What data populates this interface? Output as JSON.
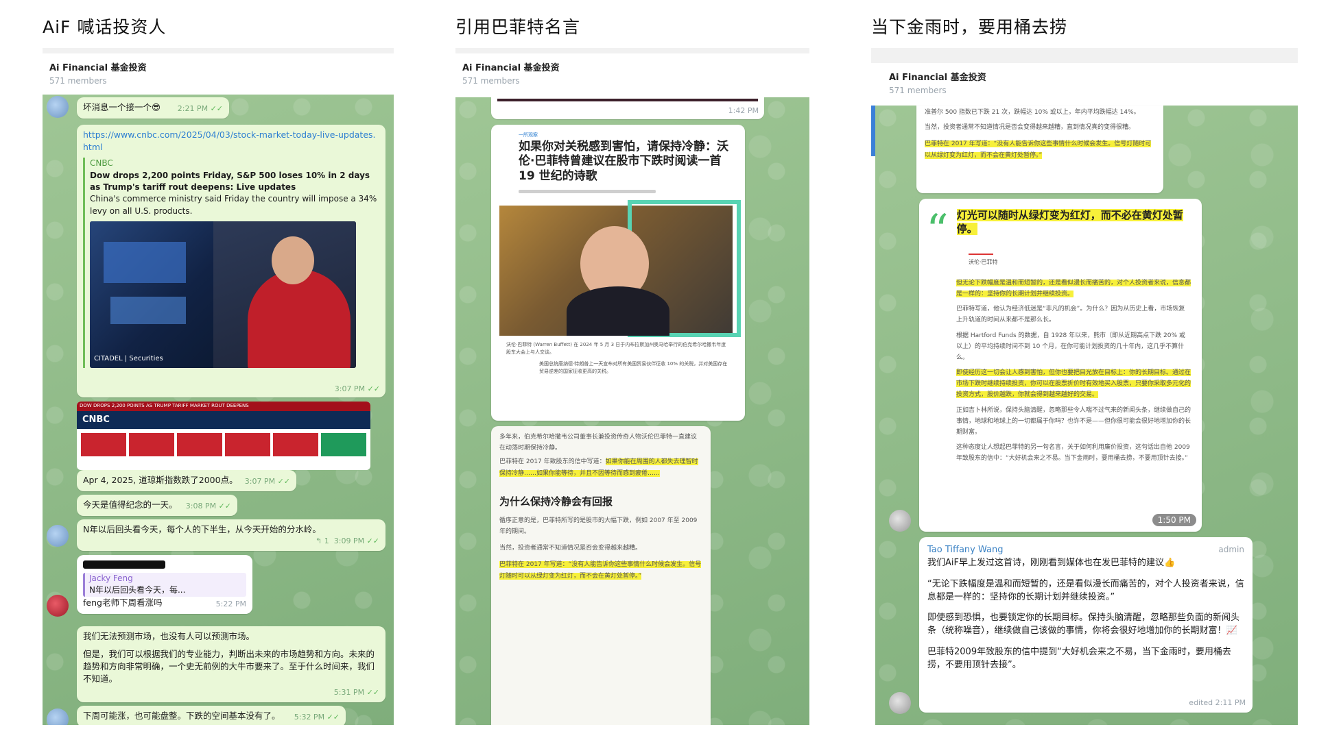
{
  "titles": [
    "AiF 喊话投资人",
    "引用巴菲特名言",
    "当下金雨时，要用桶去捞"
  ],
  "chat": {
    "name": "Ai Financial 基金投资",
    "members": "571 members"
  },
  "left": {
    "msg1": {
      "text": "坏消息一个接一个😎",
      "time": "2:21 PM"
    },
    "msg2": {
      "url": "https://www.cnbc.com/2025/04/03/stock-market-today-live-updates.html",
      "source": "CNBC",
      "headline": "Dow drops 2,200 points Friday, S&P 500 loses 10% in 2 days as Trump's tariff rout deepens: Live updates",
      "desc": "China's commerce ministry said Friday the country will impose a 34% levy on all U.S. products.",
      "img_caption": "CITADEL | Securities",
      "time": "3:07 PM"
    },
    "banner": {
      "brand": "CNBC",
      "ticker": "DOW DROPS 2,200 POINTS AS TRUMP TARIFF MARKET ROUT DEEPENS"
    },
    "msg3": {
      "text": "Apr 4, 2025, 道琼斯指数跌了2000点。",
      "time": "3:07 PM"
    },
    "msg4": {
      "text": "今天是值得纪念的一天。",
      "time": "3:08 PM"
    },
    "msg5": {
      "text": "N年以后回头看今天，每个人的下半生，从今天开始的分水岭。",
      "replies": "↰ 1",
      "time": "3:09 PM"
    },
    "msg6": {
      "reply_name": "Jacky Feng",
      "reply_text": "N年以后回头看今天，每...",
      "text": "feng老师下周看涨吗",
      "time": "5:22 PM"
    },
    "msg7": {
      "p1": "我们无法预测市场，也没有人可以预测市场。",
      "p2": "但是，我们可以根据我们的专业能力，判断出未来的市场趋势和方向。未来的趋势和方向非常明确，一个史无前例的大牛市要来了。至于什么时间来，我们不知道。",
      "time": "5:31 PM"
    },
    "msg8": {
      "text": "下周可能涨，也可能盘整。下跌的空间基本没有了。",
      "time": "5:32 PM"
    }
  },
  "mid": {
    "top_time": "1:42 PM",
    "article": {
      "tag": "一所观察",
      "headline": "如果你对关税感到害怕，请保持冷静：沃伦·巴菲特曾建议在股市下跌时阅读一首 19 世纪的诗歌",
      "caption": "沃伦·巴菲特 (Warren Buffett) 在 2024 年 5 月 3 日于内布拉斯加州奥马哈举行的伯克希尔哈撒韦年度股东大会上与人交谈。",
      "p_lead": "美国总统唐纳德·特朗普上一天宣布对所有美国贸易伙伴征收 10% 的关税，并对美国存在贸易逆差的国家征收更高的关税。",
      "section": "为什么保持冷静会有回报",
      "p_body": "多年来，伯克希尔哈撒韦公司董事长兼投资传奇人物沃伦巴菲特一直建议在动荡时期保持冷静。"
    },
    "b1": {
      "p1": "巴菲特在 2017 年致股东的信中写道：",
      "p2": "如果你能在周围的人都失去理智时保持冷静……如果你能等待，并且不因等待而感到疲倦……"
    },
    "b2": {
      "p1": "循序正意的是，巴菲特所写的是股市的大幅下跌，例如 2007 年至 2009 年的期间。",
      "p2": "当然，投资者通常不知道情况是否会变得越来越糟。",
      "p3": "巴菲特在 2017 年写道：“没有人能告诉你这些事情什么时候会发生。信号灯随时可以从绿灯变为红灯，而不会在黄灯处暂停。”"
    }
  },
  "right": {
    "card_top": {
      "p1": "准普尔 500 指数已下跌 21 次，跌幅达 10% 或以上，年内平均跌幅达 14%。",
      "p2": "当然，投资者通常不知道情况是否会变得越来越糟，直到情况真的变得很糟。",
      "p3": "巴菲特在 2017 年写道：“没有人能告诉你这些事情什么时候会发生。信号灯随时可以从绿灯变为红灯，而不会在黄灯处暂停。”"
    },
    "quote": {
      "text": "灯光可以随时从绿灯变为红灯，而不必在黄灯处暂停。",
      "author": "沃伦·巴菲特",
      "p1": "但无论下跌幅度是温和而短暂的，还是看似漫长而痛苦的，对个人投资者来说，信息都是一样的：坚持你的长期计划并继续投资。",
      "p2": "巴菲特写道，他认为经济低迷是“非凡的机会”。为什么？因为从历史上看，市场恢复上升轨道的时间从来都不是那么长。",
      "p3": "根据 Hartford Funds 的数据，自 1928 年以来，熊市（即从近期高点下跌 20% 或以上）的平均持续时间不到 10 个月，在你可能计划投资的几十年内，这几乎不算什么。",
      "p4": "即使经历这一切会让人感到害怕，但你也要把目光放在目标上：你的长期目标。通过在市场下跌时继续持续投资，你可以在股票折价时有效地买入股票，只要你采取多元化的投资方式，股价越跌，你就会得到越来越好的交易。",
      "p5": "正如吉卜林所说，保持头脑清醒，忽略那些令人喘不过气来的新闻头条，继续做自己的事情，地球和地球上的一切都属于你吗？也许不是——但你很可能会很好地增加你的长期财富。",
      "p6": "这种态度让人想起巴菲特的另一句名言，关于如何利用廉价投资，这句话出自他 2009 年致股东的信中：“大好机会来之不易。当下金雨时，要用桶去捞，不要用顶针去接。”",
      "time": "1:50 PM"
    },
    "admin_msg": {
      "sender": "Tao Tiffany Wang",
      "role": "admin",
      "line1": "我们AiF早上发过这首诗，刚刚看到媒体也在发巴菲特的建议👍",
      "line2": "“无论下跌幅度是温和而短暂的，还是看似漫长而痛苦的，对个人投资者来说，信息都是一样的：坚持你的长期计划并继续投资。”",
      "line3": "即使感到恐惧，也要锁定你的长期目标。保持头脑清醒，忽略那些负面的新闻头条（统称噪音），继续做自己该做的事情，你将会很好地增加你的长期财富！📈",
      "line4": "巴菲特2009年致股东的信中提到“大好机会来之不易，当下金雨时，要用桶去捞，不要用顶针去接”。",
      "time": "edited 2:11 PM"
    }
  },
  "colors": {
    "bubble": "#eaf8d8",
    "accent_green": "#4bbf6b",
    "link": "#2d7fd1",
    "highlight": "#f7f03a"
  }
}
